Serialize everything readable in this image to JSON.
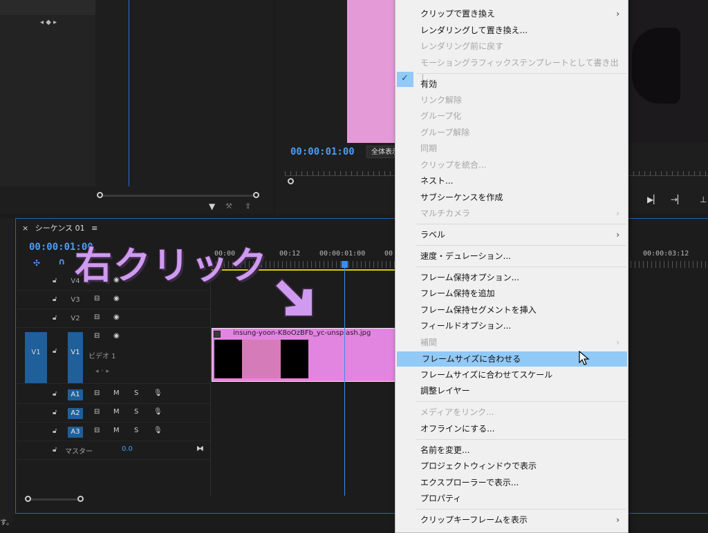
{
  "source_panel": {
    "nav": "◂ ◆ ▸"
  },
  "program": {
    "timecode": "00:00:01:00",
    "fit_label": "全体表示"
  },
  "timeline": {
    "tab_close": "×",
    "tab_title": "シーケンス 01",
    "tab_menu": "≡",
    "timecode": "00:00:01:00",
    "ruler_labels": [
      "00:00",
      "00:12",
      "00:00:01:00",
      "00",
      "00:00:03:12"
    ],
    "tracks": {
      "video": [
        {
          "name": "V4",
          "visible": true
        },
        {
          "name": "V3",
          "visible": true
        },
        {
          "name": "V2",
          "visible": true
        },
        {
          "name": "V1",
          "patch": "V1",
          "label": "ビデオ 1",
          "visible": true
        }
      ],
      "audio": [
        {
          "name": "A1",
          "m": "M",
          "s": "S"
        },
        {
          "name": "A2",
          "m": "M",
          "s": "S"
        },
        {
          "name": "A3",
          "m": "M",
          "s": "S"
        }
      ],
      "master_label": "マスター",
      "master_value": "0.0"
    },
    "clip": {
      "filename": "insung-yoon-K8oOzBFb_yc-unsplash.jpg"
    }
  },
  "annotation": {
    "text": "右クリック"
  },
  "context_menu": {
    "items": [
      {
        "label": "クリップで置き換え",
        "enabled": true,
        "submenu": true
      },
      {
        "label": "レンダリングして置き換え...",
        "enabled": true
      },
      {
        "label": "レンダリング前に戻す",
        "enabled": false
      },
      {
        "label": "モーショングラフィックステンプレートとして書き出し...",
        "enabled": false
      },
      {
        "label": "有効",
        "enabled": true,
        "checked": true
      },
      {
        "label": "リンク解除",
        "enabled": false
      },
      {
        "label": "グループ化",
        "enabled": false
      },
      {
        "label": "グループ解除",
        "enabled": false
      },
      {
        "label": "同期",
        "enabled": false
      },
      {
        "label": "クリップを統合...",
        "enabled": false
      },
      {
        "label": "ネスト...",
        "enabled": true
      },
      {
        "label": "サブシーケンスを作成",
        "enabled": true
      },
      {
        "label": "マルチカメラ",
        "enabled": false,
        "submenu": true
      },
      {
        "label": "ラベル",
        "enabled": true,
        "submenu": true
      },
      {
        "label": "速度・デュレーション...",
        "enabled": true
      },
      {
        "label": "フレーム保持オプション...",
        "enabled": true
      },
      {
        "label": "フレーム保持を追加",
        "enabled": true
      },
      {
        "label": "フレーム保持セグメントを挿入",
        "enabled": true
      },
      {
        "label": "フィールドオプション...",
        "enabled": true
      },
      {
        "label": "補間",
        "enabled": false,
        "submenu": true
      },
      {
        "label": "フレームサイズに合わせる",
        "enabled": true,
        "highlighted": true
      },
      {
        "label": "フレームサイズに合わせてスケール",
        "enabled": true
      },
      {
        "label": "調整レイヤー",
        "enabled": true
      },
      {
        "label": "メディアをリンク...",
        "enabled": false
      },
      {
        "label": "オフラインにする...",
        "enabled": true
      },
      {
        "label": "名前を変更...",
        "enabled": true
      },
      {
        "label": "プロジェクトウィンドウで表示",
        "enabled": true
      },
      {
        "label": "エクスプローラーで表示...",
        "enabled": true
      },
      {
        "label": "プロパティ",
        "enabled": true
      },
      {
        "label": "クリップキーフレームを表示",
        "enabled": true,
        "submenu": true
      }
    ]
  },
  "status_bar": {
    "text": "す。"
  },
  "colors": {
    "accent": "#4d9cf2",
    "clip_pink": "#e285e0",
    "menu_highlight": "#91c9f7",
    "annotation": "#cf9af0"
  }
}
